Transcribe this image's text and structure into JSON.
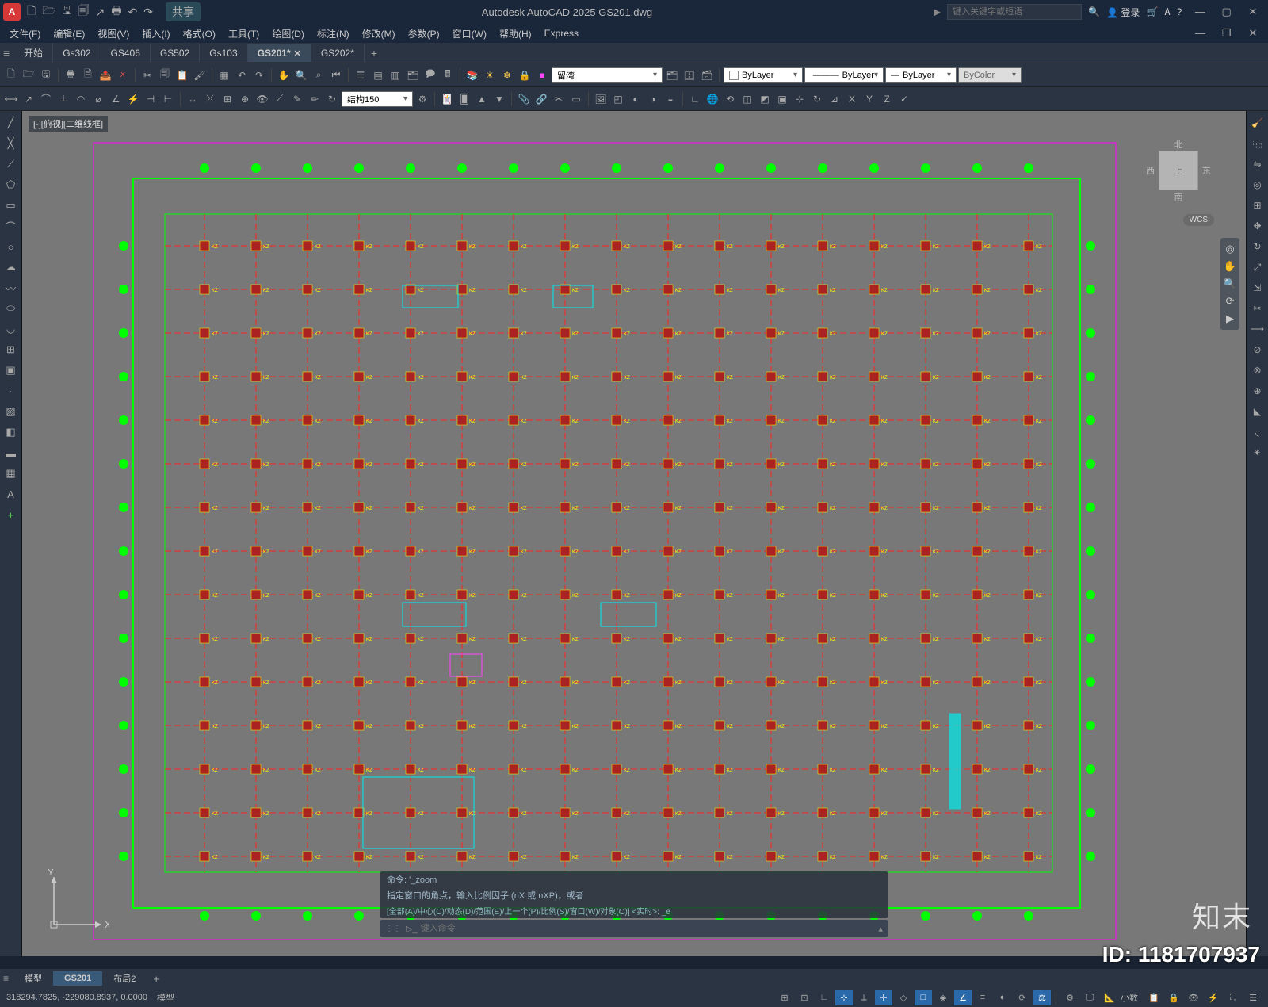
{
  "app": {
    "icon_letter": "A",
    "title": "Autodesk AutoCAD 2025   GS201.dwg",
    "search_placeholder": "键入关键字或短语",
    "login_label": "登录"
  },
  "menu": [
    "文件(F)",
    "编辑(E)",
    "视图(V)",
    "插入(I)",
    "格式(O)",
    "工具(T)",
    "绘图(D)",
    "标注(N)",
    "修改(M)",
    "参数(P)",
    "窗口(W)",
    "帮助(H)",
    "Express"
  ],
  "share_label": "共享",
  "doc_tabs": {
    "start": "开始",
    "items": [
      "Gs302",
      "GS406",
      "GS502",
      "Gs103",
      "GS201*",
      "GS202*"
    ],
    "active": "GS201*"
  },
  "layer_panel": {
    "current_layer": "留湾",
    "layer_control": "ByLayer",
    "linetype": "ByLayer",
    "lineweight": "ByLayer",
    "plot_style": "ByColor",
    "dim_style": "结构150"
  },
  "view": {
    "label": "[-][俯视][二维线框]",
    "wcs": "WCS",
    "cube_top": "上",
    "cube_n": "北",
    "cube_s": "南",
    "cube_e": "东",
    "cube_w": "西",
    "ucs_x": "X",
    "ucs_y": "Y"
  },
  "command": {
    "history_cmd": "命令:  '_zoom",
    "history_prompt": "指定窗口的角点，输入比例因子  (nX 或 nXP)，或者",
    "history_opts": "[全部(A)/中心(C)/动态(D)/范围(E)/上一个(P)/比例(S)/窗口(W)/对象(O)] <实时>: _e",
    "input_placeholder": "键入命令"
  },
  "layout_tabs": {
    "items": [
      "模型",
      "GS201",
      "布局2"
    ],
    "active": "GS201"
  },
  "status": {
    "coords": "318294.7825, -229080.8937, 0.0000",
    "mode": "模型",
    "decimal": "小数"
  },
  "watermark": {
    "id": "ID: 1181707937",
    "logo": "知末"
  }
}
